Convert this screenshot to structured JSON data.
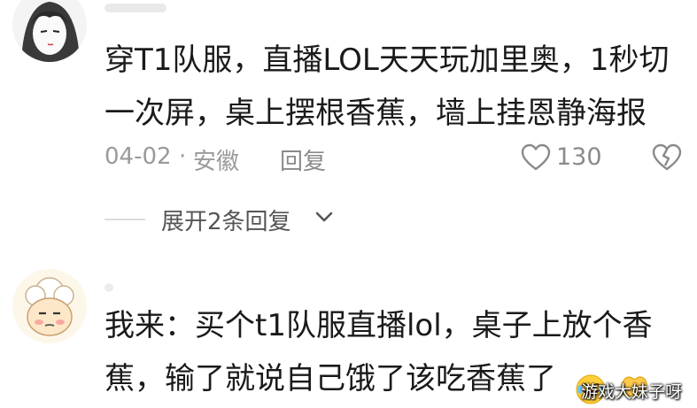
{
  "comments": [
    {
      "text": "穿T1队服，直播LOL天天玩加里奥，1秒切一次屏，桌上摆根香蕉，墙上挂恩静海报",
      "date": "04-02",
      "separator": "·",
      "location": "安徽",
      "reply_label": "回复",
      "like_count": "130",
      "expand_label": "展开2条回复"
    },
    {
      "text": "我来：买个t1队服直播lol，桌子上放个香蕉，输了就说自己饿了该吃香蕉了"
    }
  ],
  "watermark": {
    "text": "游戏大妹子呀"
  },
  "colors": {
    "meta": "#9a9a9a",
    "text": "#1a1a1a",
    "icon": "#8a8a8a"
  }
}
